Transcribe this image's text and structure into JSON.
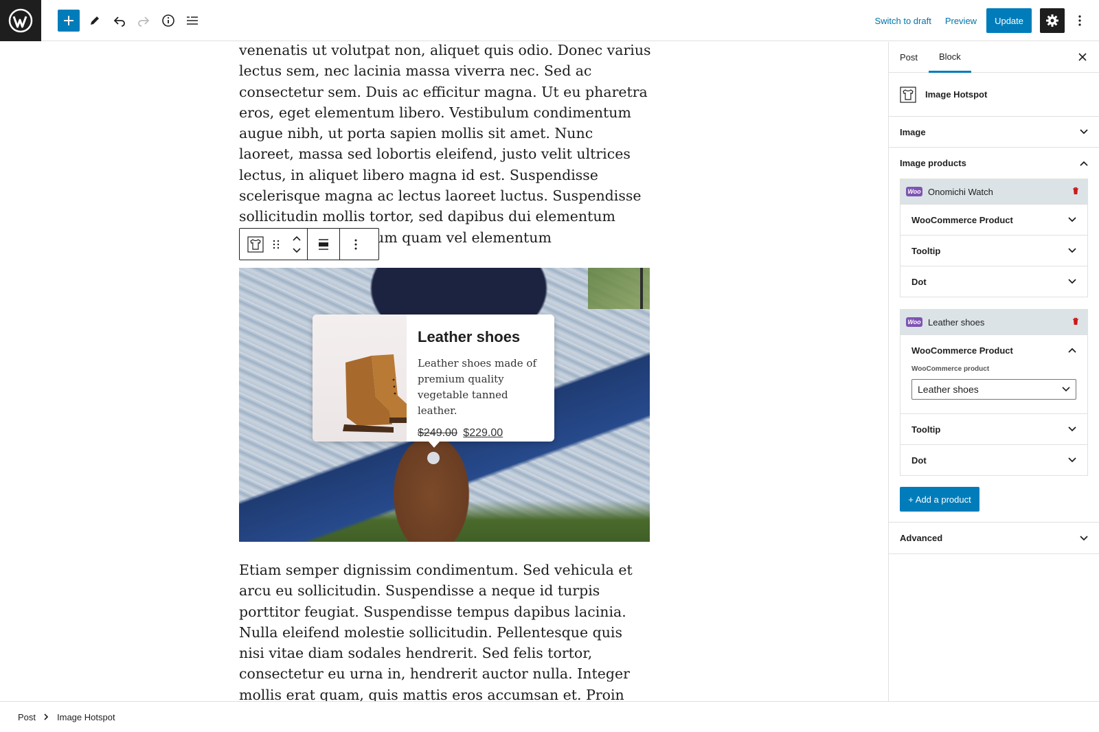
{
  "topbar": {
    "switch_to_draft": "Switch to draft",
    "preview": "Preview",
    "update": "Update"
  },
  "content": {
    "paragraph_above": "venenatis ut volutpat non, aliquet quis odio. Donec varius lectus sem, nec lacinia massa viverra nec. Sed ac consectetur sem. Duis ac efficitur magna. Ut eu pharetra eros, eget elementum libero. Vestibulum condimentum augue nibh, ut porta sapien mollis sit amet. Nunc laoreet, massa sed lobortis eleifend, justo velit ultrices lectus, in aliquet libero magna id est. Suspendisse scelerisque magna ac lectus laoreet luctus. Suspendisse sollicitudin mollis tortor, sed dapibus dui elementum eget. Fusce bibendum quam vel elementum",
    "paragraph_below": "Etiam semper dignissim condimentum. Sed vehicula et arcu eu sollicitudin. Suspendisse a neque id turpis porttitor feugiat. Suspendisse tempus dapibus lacinia. Nulla eleifend molestie sollicitudin. Pellentesque quis nisi vitae diam sodales hendrerit. Sed felis tortor, consectetur eu urna in, hendrerit auctor nulla. Integer mollis erat quam, quis mattis eros accumsan et. Proin posuere pellentesque diam ac",
    "tooltip": {
      "title": "Leather shoes",
      "description": "Leather shoes made of premium quality vegetable tanned leather.",
      "old_price": "$249.00",
      "new_price": "$229.00"
    }
  },
  "sidebar": {
    "tabs": [
      "Post",
      "Block"
    ],
    "active_tab": "Block",
    "block_name": "Image Hotspot",
    "panels": {
      "image": "Image",
      "image_products": "Image products",
      "advanced": "Advanced"
    },
    "products": [
      {
        "name": "Onomichi Watch",
        "sections": [
          "WooCommerce Product",
          "Tooltip",
          "Dot"
        ]
      },
      {
        "name": "Leather shoes",
        "sections": [
          "WooCommerce Product",
          "Tooltip",
          "Dot"
        ],
        "field_label": "WooCommerce product",
        "field_value": "Leather shoes"
      }
    ],
    "add_product": "+ Add a product",
    "woo_badge": "Woo"
  },
  "breadcrumb": [
    "Post",
    "Image Hotspot"
  ],
  "colors": {
    "accent": "#007cba",
    "dark": "#1e1e1e",
    "woo": "#7f54b3",
    "delete": "#cc1818",
    "product_header": "#dbe3e7"
  }
}
